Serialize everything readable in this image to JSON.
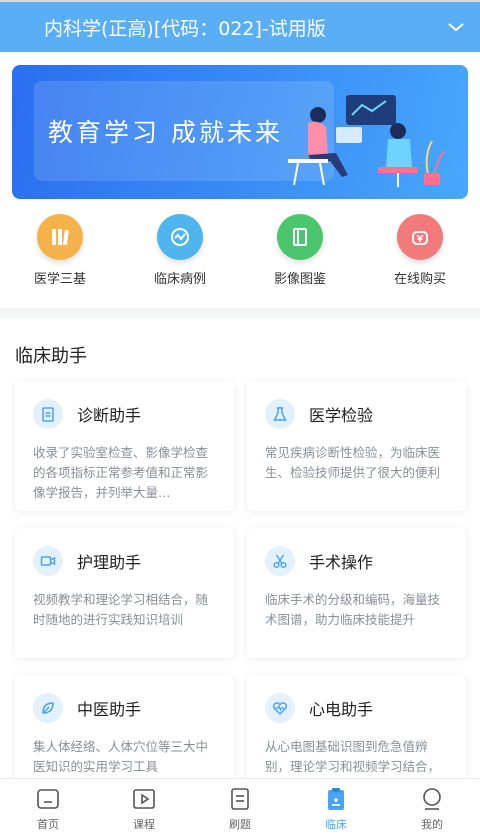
{
  "header": {
    "title": "内科学(正高)[代码：022]-试用版",
    "dropdown_icon": "chevron-down-icon"
  },
  "banner": {
    "slogan": "教育学习 成就未来"
  },
  "quick_links": [
    {
      "label": "医学三基",
      "icon": "books-icon",
      "color": "#f6b24a"
    },
    {
      "label": "临床病例",
      "icon": "chart-icon",
      "color": "#4fb5ee"
    },
    {
      "label": "影像图鉴",
      "icon": "book-icon",
      "color": "#4cc66e"
    },
    {
      "label": "在线购买",
      "icon": "money-bag-icon",
      "color": "#f27a7a"
    }
  ],
  "assistant": {
    "title": "临床助手",
    "cards": [
      {
        "title": "诊断助手",
        "icon": "clipboard-icon",
        "desc": "收录了实验室检查、影像学检查的各项指标正常参考值和正常影像学报告，并列举大量…"
      },
      {
        "title": "医学检验",
        "icon": "flask-icon",
        "desc": "常见疾病诊断性检验，为临床医生、检验技师提供了很大的便利"
      },
      {
        "title": "护理助手",
        "icon": "video-camera-icon",
        "desc": "视频教学和理论学习相结合，随时随地的进行实践知识培训"
      },
      {
        "title": "手术操作",
        "icon": "scissors-icon",
        "desc": "临床手术的分级和编码，海量技术图谱，助力临床技能提升"
      },
      {
        "title": "中医助手",
        "icon": "leaf-icon",
        "desc": "集人体经络、人体穴位等三大中医知识的实用学习工具"
      },
      {
        "title": "心电助手",
        "icon": "heart-pulse-icon",
        "desc": "从心电图基础识图到危急值辨别，理论学习和视频学习结合，覆盖各阶段临床心电图…"
      }
    ]
  },
  "tabbar": {
    "active_color": "#4aa4f3",
    "tabs": [
      {
        "label": "首页",
        "icon": "home-icon",
        "active": false
      },
      {
        "label": "课程",
        "icon": "play-icon",
        "active": false
      },
      {
        "label": "刷题",
        "icon": "document-icon",
        "active": false
      },
      {
        "label": "临床",
        "icon": "clinical-clipboard-icon",
        "active": true
      },
      {
        "label": "我的",
        "icon": "user-icon",
        "active": false
      }
    ]
  }
}
